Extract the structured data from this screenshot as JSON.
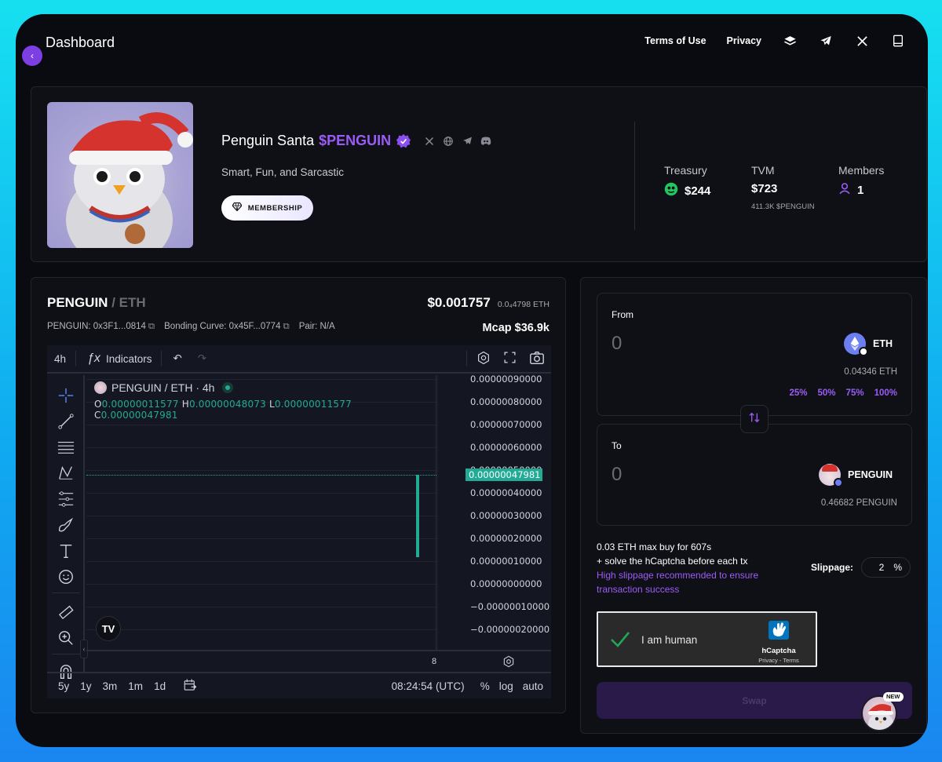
{
  "topbar": {
    "title": "Dashboard",
    "links": [
      "Terms of Use",
      "Privacy"
    ],
    "icons": [
      "layers-icon",
      "telegram-icon",
      "x-icon",
      "book-icon"
    ]
  },
  "token": {
    "name": "Penguin Santa",
    "ticker": "$PENGUIN",
    "tagline": "Smart, Fun, and Sarcastic",
    "membership_label": "MEMBERSHIP",
    "stats": {
      "treasury_label": "Treasury",
      "treasury_value": "$244",
      "tvm_label": "TVM",
      "tvm_value": "$723",
      "tvm_sub": "411.3K $PENGUIN",
      "members_label": "Members",
      "members_value": "1"
    }
  },
  "chart_panel": {
    "base": "PENGUIN",
    "quote": " / ETH",
    "price_usd": "$0.001757",
    "price_eth": "0.0₄4798 ETH",
    "contract": "PENGUIN: 0x3F1...0814",
    "bonding_curve": "Bonding Curve: 0x45F...0774",
    "pair_address": "Pair: N/A",
    "mcap": "Mcap $36.9k"
  },
  "tradingview": {
    "interval": "4h",
    "indicators_label": "Indicators",
    "legend_title": "PENGUIN / ETH · 4h",
    "ohlc": {
      "o_label": "O",
      "o": "0.00000011577",
      "h_label": "H",
      "h": "0.00000048073",
      "l_label": "L",
      "l": "0.00000011577",
      "c_label": "C",
      "c": "0.00000047981"
    },
    "last_price_label": "0.00000047981",
    "time_label": "8",
    "ranges": [
      "5y",
      "1y",
      "3m",
      "1m",
      "1d"
    ],
    "clock": "08:24:54 (UTC)",
    "scale_options": [
      "%",
      "log",
      "auto"
    ],
    "logo": "TV"
  },
  "chart_data": {
    "type": "candlestick",
    "title": "PENGUIN / ETH · 4h",
    "x": [
      "8"
    ],
    "candles": [
      {
        "open": 1.1577e-07,
        "high": 4.8073e-07,
        "low": 1.1577e-07,
        "close": 4.7981e-07
      }
    ],
    "y_ticks": [
      "0.00000090000",
      "0.00000080000",
      "0.00000070000",
      "0.00000060000",
      "0.00000050000",
      "0.00000040000",
      "0.00000030000",
      "0.00000020000",
      "0.00000010000",
      "0.00000000000",
      "−0.00000010000",
      "−0.00000020000"
    ],
    "ylim": [
      -2.5e-07,
      9e-07
    ],
    "up_color": "#22ab94",
    "grid": true
  },
  "swap": {
    "from_label": "From",
    "from_amount": "0",
    "from_token": "ETH",
    "from_balance": "0.04346 ETH",
    "percents": [
      "25%",
      "50%",
      "75%",
      "100%"
    ],
    "to_label": "To",
    "to_amount": "0",
    "to_token": "PENGUIN",
    "to_balance": "0.46682 PENGUIN",
    "limit_line1": "0.03 ETH max buy for 607s",
    "limit_line2": "+ solve the hCaptcha before each tx",
    "warning": "High slippage recommended to ensure transaction success",
    "slippage_label": "Slippage:",
    "slippage_value": "2",
    "slippage_unit": "%",
    "captcha_text": "I am human",
    "captcha_brand": "hCaptcha",
    "captcha_links": "Privacy - Terms",
    "swap_button": "Swap"
  },
  "floating": {
    "badge": "NEW"
  },
  "colors": {
    "accent": "#9b5cf6",
    "positive": "#22ab94",
    "background": "#0a0b10"
  }
}
